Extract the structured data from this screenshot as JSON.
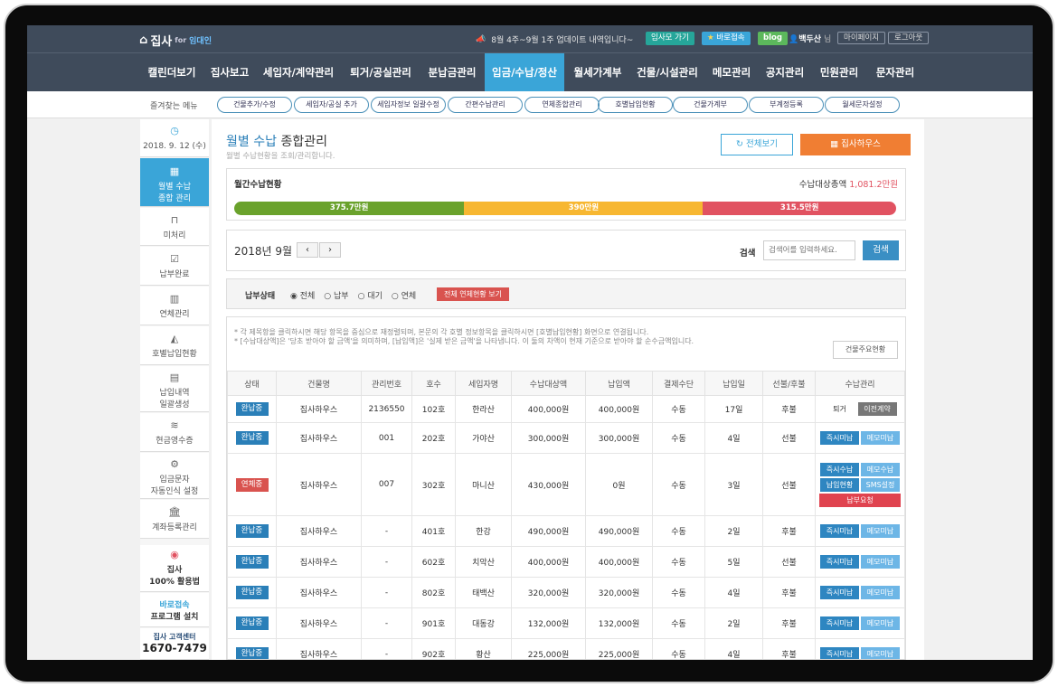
{
  "header": {
    "logo_text": "집사",
    "logo_for": "for",
    "logo_sub": "임대인",
    "notice": "8월 4주~9월 1주 업데이트 내역입니다~",
    "btn_view": "임사모 가기",
    "btn_quick": "바로접속",
    "btn_blog": "blog",
    "user_name": "백두산",
    "user_suffix": "님",
    "my_page": "마이페이지",
    "logout": "로그아웃"
  },
  "nav": [
    "캘린더보기",
    "집사보고",
    "세입자/계약관리",
    "퇴거/공실관리",
    "분납금관리",
    "입금/수납/정산",
    "월세가계부",
    "건물/시설관리",
    "메모관리",
    "공지관리",
    "민원관리",
    "문자관리"
  ],
  "favorites_label": "즐겨찾는 메뉴",
  "favorites": [
    "건물추가/수정",
    "세입자/공실 추가",
    "세입자정보 일괄수정",
    "간편수납관리",
    "연체종합관리",
    "호별납입현황",
    "건물가계부",
    "부계정등록",
    "월세문자설정"
  ],
  "sidebar": {
    "date": "2018. 9. 12 (수)",
    "items": [
      "월별 수납\n종합 관리",
      "미처리",
      "납부완료",
      "연체관리",
      "호별납입현황",
      "납입내역\n일괄생성",
      "현금영수증",
      "입금문자\n자동인식 설정",
      "계좌등록관리"
    ],
    "promo1_a": "집사",
    "promo1_b": "100% 활용법",
    "promo2_a": "바로접속",
    "promo2_b": "프로그램 설치",
    "cs_label": "집사 고객센터",
    "cs_phone": "1670-7479"
  },
  "main": {
    "title_a": "월별 수납",
    "title_b": "종합관리",
    "subtitle": "월별 수납현황을 조회/관리합니다.",
    "btn_all": "전체보기",
    "btn_house": "집사하우스",
    "status_title": "월간수납현황",
    "total_label": "수납대상총액",
    "total_value": "1,081.2만원",
    "bar": [
      {
        "label": "375.7만원",
        "value": 375.7,
        "color": "#6aa22c"
      },
      {
        "label": "390만원",
        "value": 390,
        "color": "#f7b731"
      },
      {
        "label": "315.5만원",
        "value": 315.5,
        "color": "#e15261"
      }
    ],
    "month": "2018년 9월",
    "search_label": "검색",
    "search_placeholder": "검색어를 입력하세요.",
    "search_btn": "검색",
    "filter_label": "납부상태",
    "filters": [
      "전체",
      "납부",
      "대기",
      "연체"
    ],
    "filter_btn": "전체 연체현황 보기",
    "notes": [
      "* 각 제목항을 클릭하시면 해당 항목을 중심으로 재정렬되며, 본문의 각 호별 정보항목을 클릭하시면 [호별납입현황] 화면으로 연결됩니다.",
      "* [수납대상액]은 '당초 받아야 할 금액'을 의미하며, [납입액]은 '실제 받은 금액'을 나타냅니다. 이 둘의 차액이 현재 기준으로 받아야 할 순수금액입니다."
    ],
    "building_note_btn": "건물주요현황",
    "columns": [
      "상태",
      "건물명",
      "관리번호",
      "호수",
      "세입자명",
      "수납대상액",
      "납입액",
      "결제수단",
      "납입일",
      "선불/후불",
      "수납관리"
    ],
    "rows": [
      {
        "status": "완납중",
        "building": "집사하우스",
        "id": "2136550",
        "unit": "102호",
        "tenant": "한라산",
        "due": "400,000원",
        "paid": "400,000원",
        "method": "수동",
        "day": "17일",
        "type": "후불",
        "actions": [
          "퇴거",
          "이전계약"
        ]
      },
      {
        "status": "완납중",
        "building": "집사하우스",
        "id": "001",
        "unit": "202호",
        "tenant": "가야산",
        "due": "300,000원",
        "paid": "300,000원",
        "method": "수동",
        "day": "4일",
        "type": "선불",
        "actions": [
          "즉시미납",
          "메모미납"
        ]
      },
      {
        "status": "연체중",
        "building": "집사하우스",
        "id": "007",
        "unit": "302호",
        "tenant": "마니산",
        "due": "430,000원",
        "paid": "0원",
        "method": "수동",
        "day": "3일",
        "type": "선불",
        "actions": [
          "즉시수납",
          "메모수납",
          "납입현황",
          "SMS설정",
          "납부요청"
        ]
      },
      {
        "status": "완납중",
        "building": "집사하우스",
        "id": "-",
        "unit": "401호",
        "tenant": "한강",
        "due": "490,000원",
        "paid": "490,000원",
        "method": "수동",
        "day": "2일",
        "type": "후불",
        "actions": [
          "즉시미납",
          "메모미납"
        ]
      },
      {
        "status": "완납중",
        "building": "집사하우스",
        "id": "-",
        "unit": "602호",
        "tenant": "치악산",
        "due": "400,000원",
        "paid": "400,000원",
        "method": "수동",
        "day": "5일",
        "type": "선불",
        "actions": [
          "즉시미납",
          "메모미납"
        ]
      },
      {
        "status": "완납중",
        "building": "집사하우스",
        "id": "-",
        "unit": "802호",
        "tenant": "태백산",
        "due": "320,000원",
        "paid": "320,000원",
        "method": "수동",
        "day": "4일",
        "type": "후불",
        "actions": [
          "즉시미납",
          "메모미납"
        ]
      },
      {
        "status": "완납중",
        "building": "집사하우스",
        "id": "-",
        "unit": "901호",
        "tenant": "대동강",
        "due": "132,000원",
        "paid": "132,000원",
        "method": "수동",
        "day": "2일",
        "type": "후불",
        "actions": [
          "즉시미납",
          "메모미납"
        ]
      },
      {
        "status": "완납중",
        "building": "집사하우스",
        "id": "-",
        "unit": "902호",
        "tenant": "황산",
        "due": "225,000원",
        "paid": "225,000원",
        "method": "수동",
        "day": "4일",
        "type": "후불",
        "actions": [
          "즉시미납",
          "메모미납"
        ]
      }
    ]
  },
  "colors": {
    "accent": "#3aa5d8",
    "nav": "#3f4b5b",
    "paid": "#2a7fb8",
    "overdue": "#d9534f",
    "orange": "#f07e33"
  }
}
